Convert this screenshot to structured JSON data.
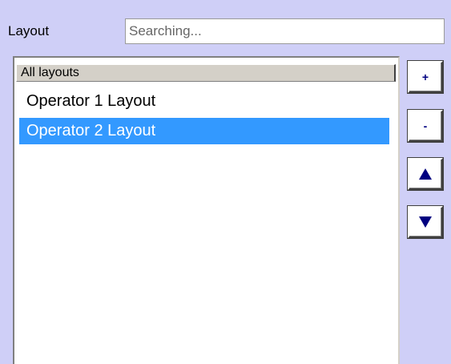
{
  "header": {
    "label": "Layout",
    "search_placeholder": "Searching..."
  },
  "list": {
    "header": "All layouts",
    "items": [
      {
        "label": "Operator 1 Layout",
        "selected": false
      },
      {
        "label": "Operator 2 Layout",
        "selected": true
      }
    ]
  },
  "buttons": {
    "add_label": "+",
    "remove_label": "-",
    "move_up_icon": "triangle-up-icon",
    "move_down_icon": "triangle-down-icon"
  },
  "colors": {
    "background": "#cfcff7",
    "selection": "#3399ff",
    "button_glyph": "#000080"
  }
}
